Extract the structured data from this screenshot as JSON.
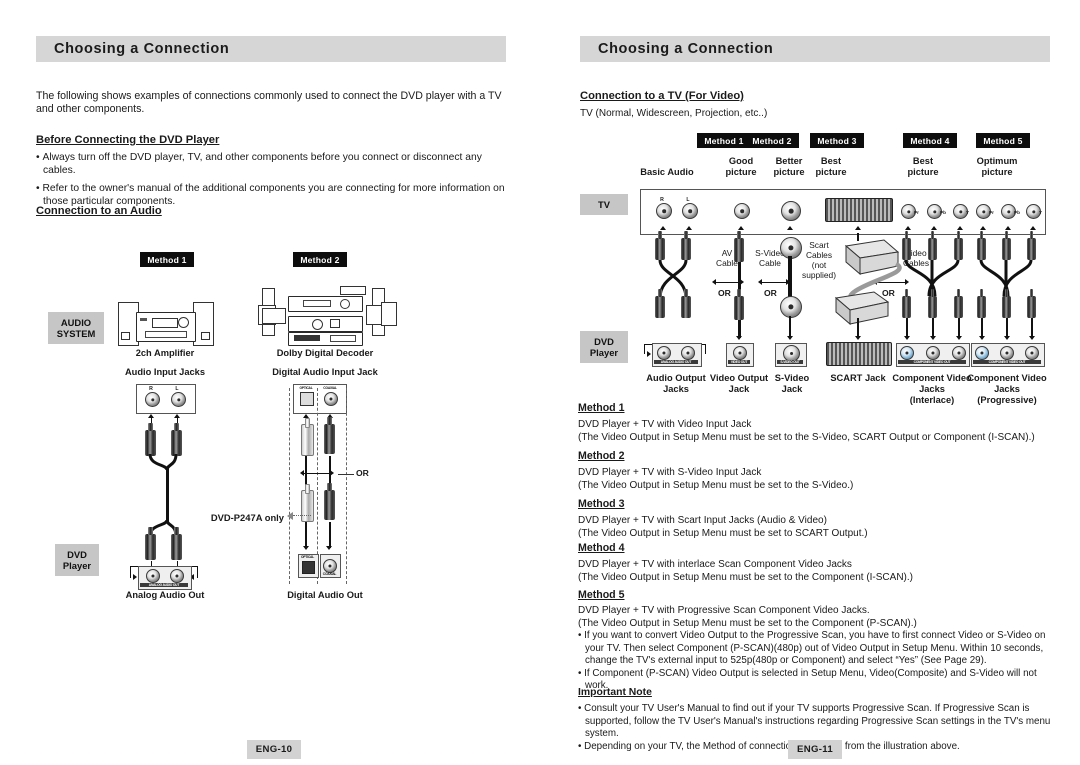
{
  "left_page": {
    "header": "Choosing a Connection",
    "intro": "The following shows examples of connections commonly used to connect the DVD player with a TV and other components.",
    "section1_title": "Before Connecting the DVD Player",
    "bullets": [
      "Always turn off the DVD player, TV, and other components before you connect or disconnect any cables.",
      "Refer to the owner's manual of the additional components you are connecting for more information on those particular components."
    ],
    "section2_title": "Connection to an Audio",
    "method1_tag": "Method 1",
    "method2_tag": "Method 2",
    "audio_system_label": "AUDIO\nSYSTEM",
    "audio_system_line1": "AUDIO",
    "audio_system_line2": "SYSTEM",
    "dvd_player_line1": "DVD",
    "dvd_player_line2": "Player",
    "amp_label": "2ch Amplifier",
    "decoder_label": "Dolby Digital Decoder",
    "audio_input_jacks": "Audio Input Jacks",
    "digital_audio_input_jack": "Digital Audio Input Jack",
    "analog_audio_out": "Analog Audio Out",
    "digital_audio_out": "Digital Audio Out",
    "or_label": "OR",
    "model_note": "DVD-P247A only",
    "jack_r": "R",
    "jack_l": "L",
    "optical_label": "OPTICAL",
    "coaxial_label": "COAXIAL",
    "analog_out_caption": "ANALOG AUDIO OUT",
    "page_number": "ENG-10"
  },
  "right_page": {
    "header": "Choosing a Connection",
    "section_title": "Connection to a TV (For Video)",
    "subtitle": "TV (Normal, Widescreen, Projection, etc..)",
    "method_tags": [
      "Method 1",
      "Method 2",
      "Method 3",
      "Method 4",
      "Method 5"
    ],
    "quality_labels": [
      "Basic Audio",
      "Good\npicture",
      "Better\npicture",
      "Best\npicture",
      "Best\npicture",
      "Optimum\npicture"
    ],
    "quality": [
      {
        "l1": "",
        "l2": "Basic Audio"
      },
      {
        "l1": "Good",
        "l2": "picture"
      },
      {
        "l1": "Better",
        "l2": "picture"
      },
      {
        "l1": "Best",
        "l2": "picture"
      },
      {
        "l1": "Best",
        "l2": "picture"
      },
      {
        "l1": "Optimum",
        "l2": "picture"
      }
    ],
    "tv_label": "TV",
    "dvd_player_line1": "DVD",
    "dvd_player_line2": "Player",
    "cable_labels": [
      {
        "l1": "AV",
        "l2": "Cable",
        "l3": "",
        "l4": ""
      },
      {
        "l1": "S-Video",
        "l2": "Cable",
        "l3": "",
        "l4": ""
      },
      {
        "l1": "Scart",
        "l2": "Cables",
        "l3": "(not",
        "l4": "supplied)"
      },
      {
        "l1": "Video",
        "l2": "Cables",
        "l3": "",
        "l4": ""
      }
    ],
    "or_label": "OR",
    "jack_captions": [
      {
        "l1": "Audio Output",
        "l2": "Jacks",
        "l3": ""
      },
      {
        "l1": "Video Output",
        "l2": "Jack",
        "l3": ""
      },
      {
        "l1": "S-Video",
        "l2": "Jack",
        "l3": ""
      },
      {
        "l1": "SCART Jack",
        "l2": "",
        "l3": ""
      },
      {
        "l1": "Component Video",
        "l2": "Jacks",
        "l3": "(Interlace)"
      },
      {
        "l1": "Component Video",
        "l2": "Jacks",
        "l3": "(Progressive)"
      }
    ],
    "jack_r": "R",
    "jack_l": "L",
    "comp_labels": [
      "Pr",
      "Pb",
      "Y"
    ],
    "methods": [
      {
        "title": "Method 1",
        "lines": [
          "DVD Player + TV with Video Input Jack",
          "(The Video Output in Setup Menu must be set to the S-Video, SCART Output or Component (I-SCAN).)"
        ]
      },
      {
        "title": "Method 2",
        "lines": [
          "DVD Player + TV with S-Video Input Jack",
          "(The Video Output in Setup Menu must be set to the S-Video.)"
        ]
      },
      {
        "title": "Method 3",
        "lines": [
          "DVD Player + TV with Scart Input Jacks (Audio & Video)",
          "(The Video Output in Setup Menu must be set to SCART Output.)"
        ]
      },
      {
        "title": "Method 4",
        "lines": [
          "DVD Player + TV with interlace Scan Component Video Jacks",
          "(The Video Output in Setup Menu must be set to the Component (I-SCAN).)"
        ]
      },
      {
        "title": "Method 5",
        "lines": [
          "DVD Player + TV with Progressive Scan Component Video Jacks.",
          "(The Video Output in Setup Menu must be set to the Component (P-SCAN).)"
        ]
      }
    ],
    "method5_bullets": [
      "If you want to convert Video Output to the Progressive Scan, you have to first connect Video or S-Video on your TV. Then select Component (P-SCAN)(480p) out of Video Output in Setup Menu. Within 10 seconds, change the TV's external input to 525p(480p or Component) and select “Yes” (See Page 29).",
      "If Component (P-SCAN) Video Output is selected in Setup Menu, Video(Composite) and S-Video will not work."
    ],
    "important_note_title": "Important Note",
    "important_note_bullets": [
      "Consult your TV User's Manual to find out if your TV supports Progressive Scan. If Progressive Scan is supported, follow the TV User's Manual's instructions regarding Progressive Scan settings in the TV's menu system.",
      "Depending on your TV, the Method of connection may differ from the illustration above."
    ],
    "page_number": "ENG-11"
  },
  "colors": {
    "header_bar": "#d6d6d6",
    "tag_black": "#0d0d0d",
    "tag_gray": "#c6c6c6",
    "page_badge": "#d2d2d2",
    "jack_blue": "#2e6a96"
  }
}
